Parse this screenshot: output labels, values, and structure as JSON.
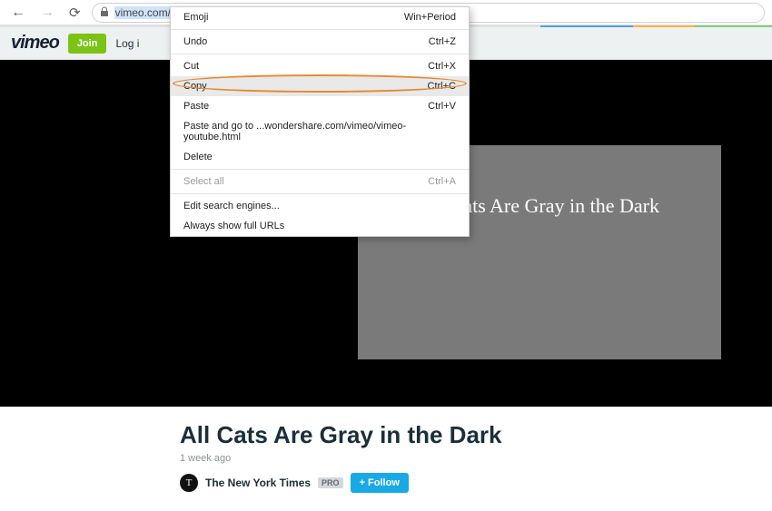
{
  "browser": {
    "url_selected": "vimeo.com/45618",
    "url_rest": ""
  },
  "context_menu": {
    "items": [
      {
        "label": "Emoji",
        "shortcut": "Win+Period",
        "dim": false
      },
      {
        "sep": true
      },
      {
        "label": "Undo",
        "shortcut": "Ctrl+Z",
        "dim": false
      },
      {
        "sep": true
      },
      {
        "label": "Cut",
        "shortcut": "Ctrl+X",
        "dim": false
      },
      {
        "label": "Copy",
        "shortcut": "Ctrl+C",
        "dim": false,
        "highlight": true
      },
      {
        "label": "Paste",
        "shortcut": "Ctrl+V",
        "dim": false
      },
      {
        "label": "Paste and go to ...wondershare.com/vimeo/vimeo-youtube.html",
        "shortcut": "",
        "dim": false
      },
      {
        "label": "Delete",
        "shortcut": "",
        "dim": false
      },
      {
        "sep": true
      },
      {
        "label": "Select all",
        "shortcut": "Ctrl+A",
        "dim": true
      },
      {
        "sep": true
      },
      {
        "label": "Edit search engines...",
        "shortcut": "",
        "dim": false
      },
      {
        "label": "Always show full URLs",
        "shortcut": "",
        "dim": false
      }
    ]
  },
  "header": {
    "logo": "vimeo",
    "join": "Join",
    "login": "Log i"
  },
  "video": {
    "overlay_title": "All Cats Are Gray in the Dark"
  },
  "below": {
    "title": "All Cats Are Gray in the Dark",
    "time_ago": "1 week ago",
    "avatar_letter": "T",
    "author": "The New York Times",
    "pro": "PRO",
    "follow": "+ Follow"
  }
}
